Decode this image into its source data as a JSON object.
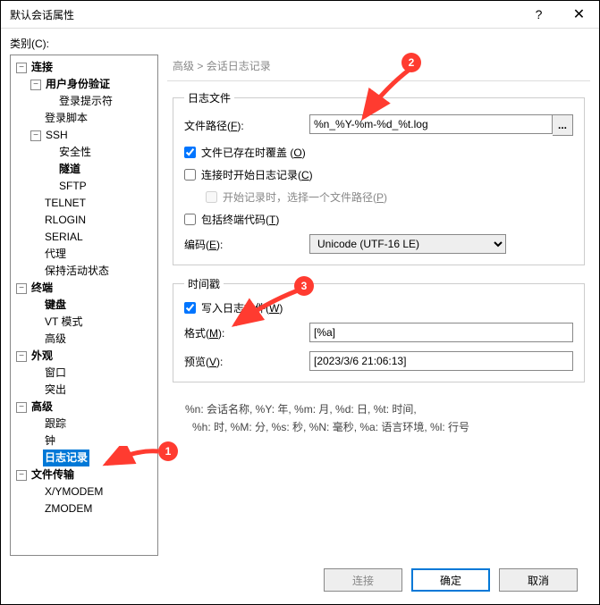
{
  "title": "默认会话属性",
  "category_label": "类别(C):",
  "tree": {
    "connection": "连接",
    "user_auth": "用户身份验证",
    "login_prompt": "登录提示符",
    "login_script": "登录脚本",
    "ssh": "SSH",
    "security": "安全性",
    "tunnel": "隧道",
    "sftp": "SFTP",
    "telnet": "TELNET",
    "rlogin": "RLOGIN",
    "serial": "SERIAL",
    "proxy": "代理",
    "keepalive": "保持活动状态",
    "terminal": "终端",
    "keyboard": "键盘",
    "vtmode": "VT 模式",
    "terminal_adv": "高级",
    "appearance": "外观",
    "window": "窗口",
    "highlight": "突出",
    "advanced": "高级",
    "trace": "跟踪",
    "bell": "钟",
    "logging": "日志记录",
    "filetransfer": "文件传输",
    "xymodem": "X/YMODEM",
    "zmodem": "ZMODEM"
  },
  "breadcrumb": {
    "parent": "高级",
    "sep": ">",
    "current": "会话日志记录"
  },
  "log_file": {
    "group": "日志文件",
    "path_label": "文件路径(F):",
    "path_value": "%n_%Y-%m-%d_%t.log",
    "browse": "...",
    "overwrite": "文件已存在时覆盖 (O)",
    "start_on_connect": "连接时开始日志记录(C)",
    "start_hint": "开始记录时，选择一个文件路径(P)",
    "include_term": "包括终端代码(T)",
    "encoding_label": "编码(E):",
    "encoding_value": "Unicode (UTF-16 LE)"
  },
  "timestamp": {
    "group": "时间戳",
    "write": "写入日志文件(W)",
    "format_label": "格式(M):",
    "format_value": "[%a]",
    "preview_label": "预览(V):",
    "preview_value": "[2023/3/6 21:06:13]"
  },
  "hint1": "%n: 会话名称, %Y: 年, %m: 月, %d: 日, %t: 时间,",
  "hint2": "%h: 时, %M: 分, %s: 秒, %N: 毫秒, %a: 语言环境, %l: 行号",
  "buttons": {
    "connect": "连接",
    "ok": "确定",
    "cancel": "取消"
  },
  "anno": {
    "b1": "1",
    "b2": "2",
    "b3": "3"
  }
}
